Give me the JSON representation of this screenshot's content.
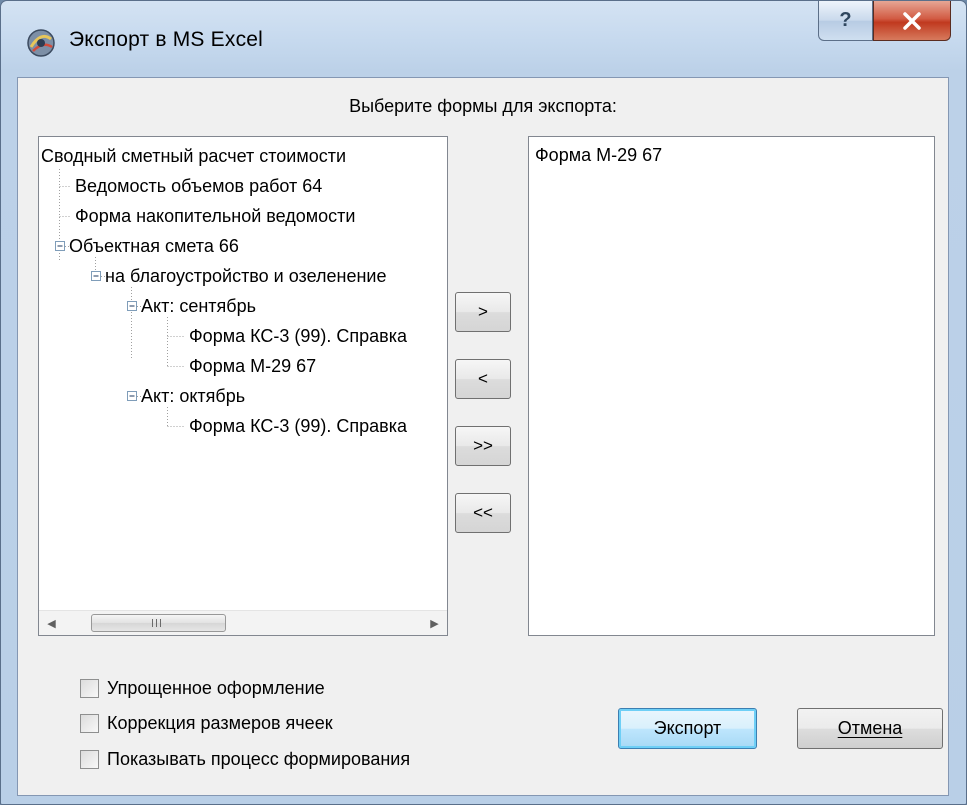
{
  "window": {
    "title": "Экспорт в MS Excel",
    "help_label": "?",
    "icon": "excel-export-icon"
  },
  "dialog": {
    "prompt": "Выберите формы для экспорта:"
  },
  "tree": {
    "items": [
      {
        "label": "Сводный сметный расчет стоимости",
        "expander": false
      },
      {
        "label": "Ведомость объемов работ 64",
        "expander": false
      },
      {
        "label": "Форма накопительной ведомости",
        "expander": false
      },
      {
        "label": "Объектная смета 66",
        "expander": true,
        "expanded": true
      },
      {
        "label": "на благоустройство и озеленение",
        "expander": true,
        "expanded": true
      },
      {
        "label": "Акт: сентябрь",
        "expander": true,
        "expanded": true
      },
      {
        "label": "Форма КС-3 (99). Справка",
        "expander": false
      },
      {
        "label": "Форма М-29 67",
        "expander": false
      },
      {
        "label": "Акт: октябрь",
        "expander": true,
        "expanded": true
      },
      {
        "label": "Форма КС-3 (99). Справка",
        "expander": false
      }
    ],
    "scroll_left_icon": "arrow-left-icon",
    "scroll_right_icon": "arrow-right-icon"
  },
  "move_buttons": {
    "add": ">",
    "remove": "<",
    "add_all": ">>",
    "remove_all": "<<"
  },
  "selected": {
    "items": [
      "Форма М-29 67"
    ]
  },
  "options": {
    "simplified": {
      "label": "Упрощенное оформление",
      "checked": false
    },
    "cell_correction": {
      "label": "Коррекция размеров ячеек",
      "checked": false
    },
    "show_progress": {
      "label": "Показывать процесс формирования",
      "checked": false
    }
  },
  "actions": {
    "export_label": "Экспорт",
    "cancel_label": "Отмена"
  },
  "colors": {
    "titlebar": "#c6d9ee",
    "close": "#c0391f",
    "client_bg": "#f0f0f0",
    "default_button_border": "#3c7fb1"
  }
}
